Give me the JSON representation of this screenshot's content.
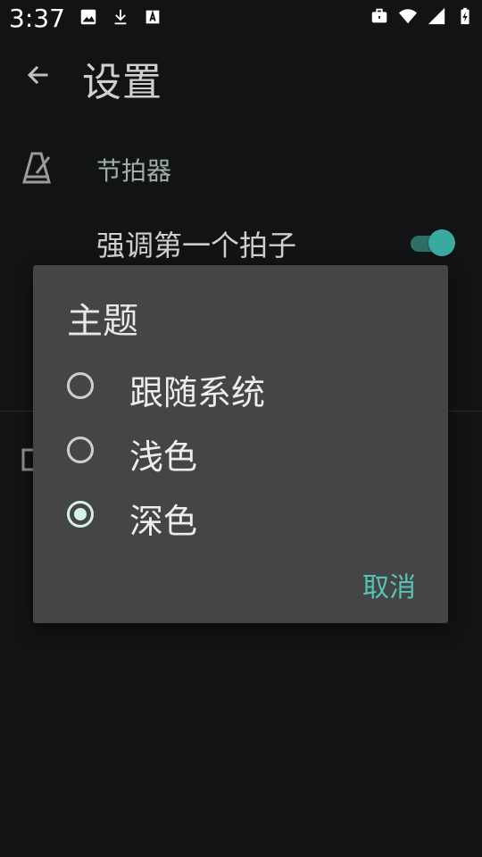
{
  "status_bar": {
    "time": "3:37",
    "left_icons": [
      "image-icon",
      "download-icon",
      "font-icon"
    ],
    "right_icons": [
      "briefcase-icon",
      "wifi-icon",
      "signal-icon",
      "battery-icon"
    ]
  },
  "app_bar": {
    "title": "设置",
    "back_icon": "arrow-back-icon"
  },
  "settings": {
    "section_title": "节拍器",
    "section_icon": "metronome-icon",
    "emphasize_first_beat": {
      "label": "强调第一个拍子",
      "enabled": true
    }
  },
  "dialog": {
    "title": "主题",
    "options": [
      {
        "label": "跟随系统",
        "selected": false
      },
      {
        "label": "浅色",
        "selected": false
      },
      {
        "label": "深色",
        "selected": true
      }
    ],
    "cancel_label": "取消"
  },
  "colors": {
    "background": "#121314",
    "dialog": "#454546",
    "accent": "#54c4b3",
    "switch_thumb": "#3aa99f"
  }
}
